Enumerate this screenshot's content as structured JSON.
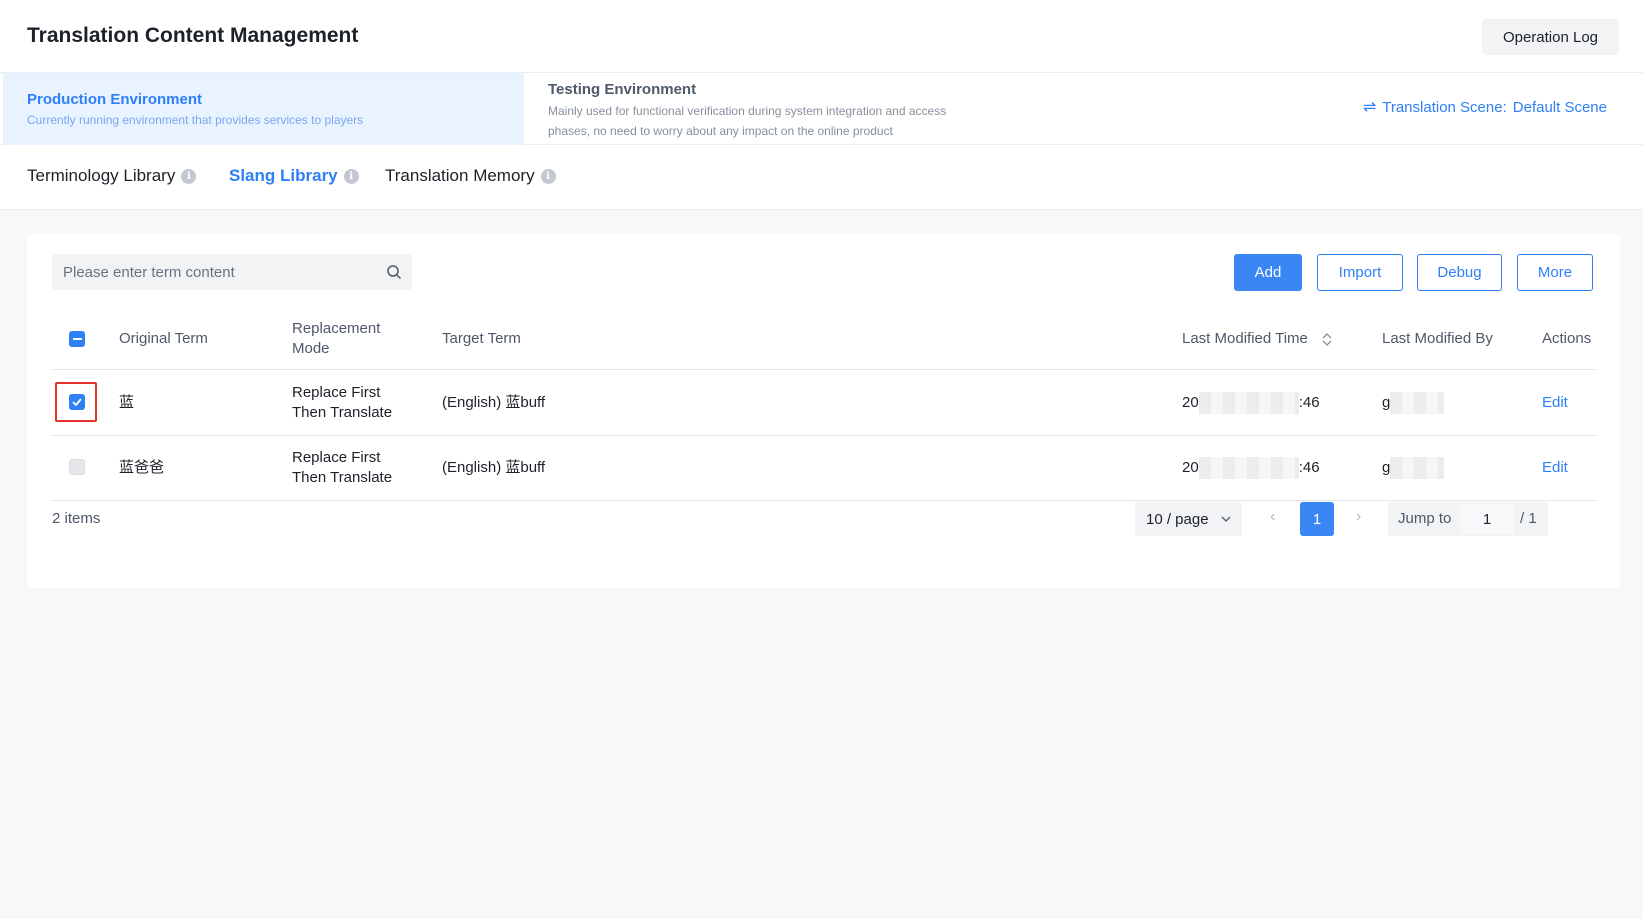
{
  "header": {
    "title": "Translation Content Management",
    "operation_log": "Operation Log"
  },
  "environments": {
    "production": {
      "title": "Production Environment",
      "desc": "Currently running environment that provides services to players"
    },
    "testing": {
      "title": "Testing Environment",
      "desc": "Mainly used for functional verification during system integration and access phases, no need to worry about any impact on the online product"
    },
    "scene_label": "Translation Scene",
    "scene_sep": ":",
    "scene_value": "Default Scene"
  },
  "tabs": [
    {
      "label": "Terminology Library"
    },
    {
      "label": "Slang Library"
    },
    {
      "label": "Translation Memory"
    }
  ],
  "toolbar": {
    "search_placeholder": "Please enter term content",
    "add": "Add",
    "import": "Import",
    "debug": "Debug",
    "more": "More"
  },
  "table": {
    "columns": {
      "original": "Original Term",
      "mode_line1": "Replacement",
      "mode_line2": "Mode",
      "target": "Target Term",
      "modified_time": "Last Modified Time",
      "modified_by": "Last Modified By",
      "actions": "Actions"
    },
    "rows": [
      {
        "checked": true,
        "original": "蓝",
        "mode_line1": "Replace First",
        "mode_line2": "Then Translate",
        "target": "(English) 蓝buff",
        "time_start": "20",
        "time_end": ":46",
        "by_start": "g",
        "action": "Edit"
      },
      {
        "checked": false,
        "original": "蓝爸爸",
        "mode_line1": "Replace First",
        "mode_line2": "Then Translate",
        "target": "(English) 蓝buff",
        "time_start": "20",
        "time_end": ":46",
        "by_start": "g",
        "action": "Edit"
      }
    ]
  },
  "pagination": {
    "total": "2 items",
    "page_size": "10 / page",
    "current": "1",
    "jump_label": "Jump to",
    "jump_value": "1",
    "total_pages": "/ 1"
  },
  "colors": {
    "primary": "#2f7ff5",
    "highlight": "#e5322d"
  }
}
